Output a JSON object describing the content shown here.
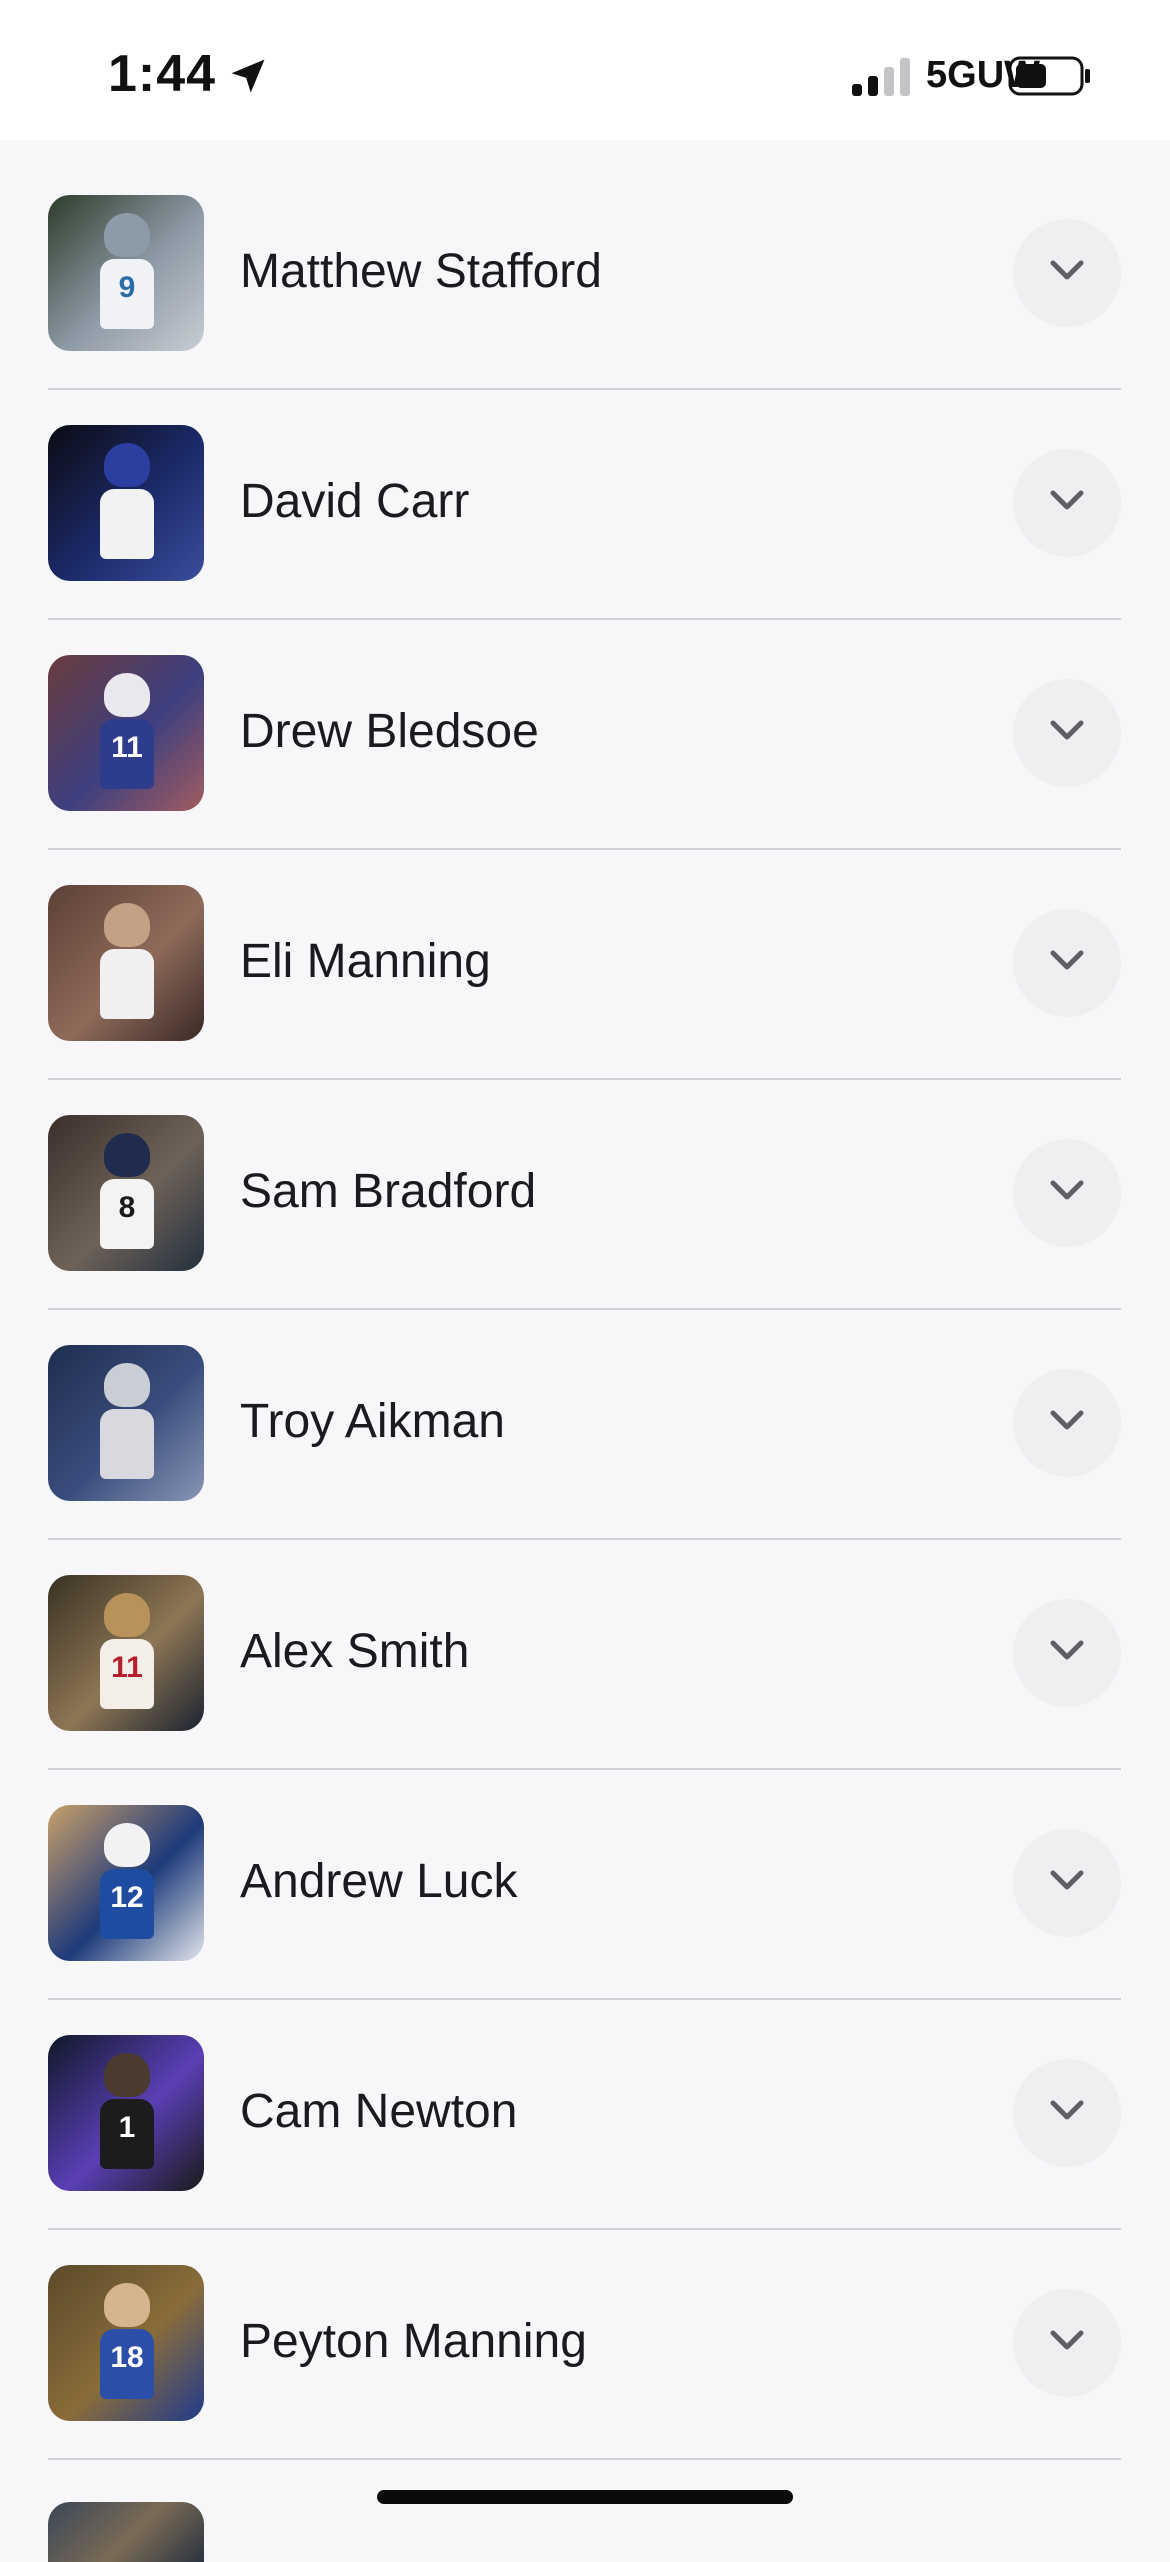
{
  "status_bar": {
    "time": "1:44",
    "network": "5GUW"
  },
  "players": [
    {
      "name": "Matthew Stafford",
      "number": "9",
      "photo_colors": [
        "#2d3b2a",
        "#8e9aa6",
        "#c7cdd4"
      ],
      "jersey_color": "#f0f2f5",
      "helmet_color": "#8d9aa8",
      "number_color": "#2a6ca8"
    },
    {
      "name": "David Carr",
      "number": "",
      "photo_colors": [
        "#0b0c12",
        "#1c2a6a",
        "#3a4c9c"
      ],
      "jersey_color": "#f2f2f2",
      "helmet_color": "#2a3fa0",
      "number_color": "#c81e2e"
    },
    {
      "name": "Drew Bledsoe",
      "number": "11",
      "photo_colors": [
        "#6a3c3e",
        "#3d3f7f",
        "#a35c5f"
      ],
      "jersey_color": "#2e3c8e",
      "helmet_color": "#e8e8ee",
      "number_color": "#ffffff"
    },
    {
      "name": "Eli Manning",
      "number": "",
      "photo_colors": [
        "#5b3f36",
        "#8f6a5a",
        "#3a2a26"
      ],
      "jersey_color": "#f1eff1",
      "helmet_color": "#c4a085",
      "number_color": "#2a3a90"
    },
    {
      "name": "Sam Bradford",
      "number": "8",
      "photo_colors": [
        "#3a2f2a",
        "#6e6258",
        "#24303e"
      ],
      "jersey_color": "#f3f3f3",
      "helmet_color": "#1f2c4e",
      "number_color": "#1a1a1a"
    },
    {
      "name": "Troy Aikman",
      "number": "",
      "photo_colors": [
        "#1f2d4f",
        "#3b4d7d",
        "#8796b5"
      ],
      "jersey_color": "#d8d8de",
      "helmet_color": "#c9cdd6",
      "number_color": "#1a1a1a"
    },
    {
      "name": "Alex Smith",
      "number": "11",
      "photo_colors": [
        "#3a3124",
        "#8c7654",
        "#1c2230"
      ],
      "jersey_color": "#f3efe8",
      "helmet_color": "#b8925a",
      "number_color": "#b51f2d"
    },
    {
      "name": "Andrew Luck",
      "number": "12",
      "photo_colors": [
        "#c9a06a",
        "#1d3a7a",
        "#e2e6ea"
      ],
      "jersey_color": "#1e4ca0",
      "helmet_color": "#f2f2f5",
      "number_color": "#ffffff"
    },
    {
      "name": "Cam Newton",
      "number": "1",
      "photo_colors": [
        "#101826",
        "#5a3fb5",
        "#1a1a1a"
      ],
      "jersey_color": "#1c1c1e",
      "helmet_color": "#4b3b2e",
      "number_color": "#ffffff"
    },
    {
      "name": "Peyton Manning",
      "number": "18",
      "photo_colors": [
        "#5a4a2a",
        "#8a6c3a",
        "#1f3a8a"
      ],
      "jersey_color": "#2b4fa8",
      "helmet_color": "#d4b58e",
      "number_color": "#ffffff"
    }
  ]
}
